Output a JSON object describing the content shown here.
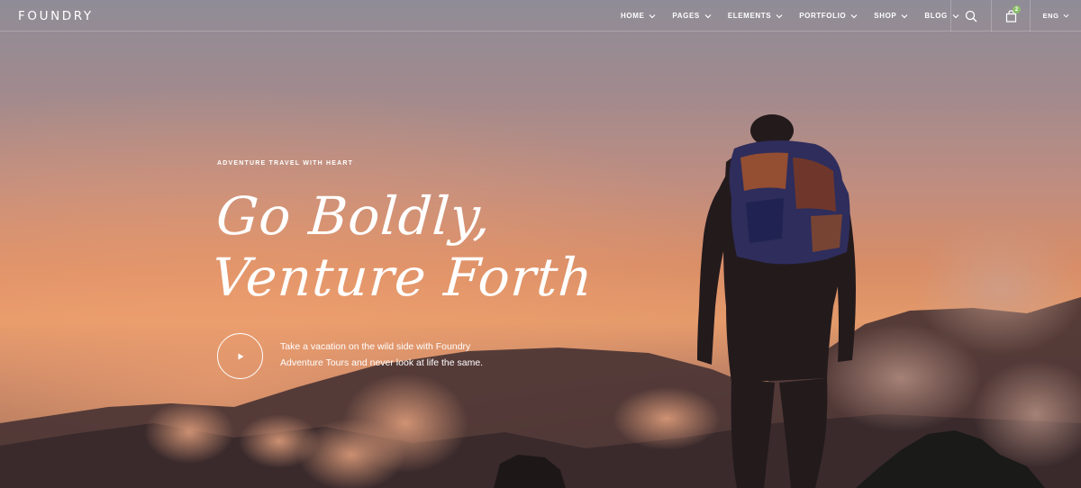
{
  "brand": {
    "logo_text": "FOUNDRY"
  },
  "nav": {
    "items": [
      {
        "label": "HOME"
      },
      {
        "label": "PAGES"
      },
      {
        "label": "ELEMENTS"
      },
      {
        "label": "PORTFOLIO"
      },
      {
        "label": "SHOP"
      },
      {
        "label": "BLOG"
      }
    ],
    "search_icon": "search-icon",
    "cart_icon": "shopping-bag-icon",
    "cart_count": "2",
    "language": "ENG"
  },
  "hero": {
    "eyebrow": "ADVENTURE TRAVEL WITH HEART",
    "headline_line1": "Go Boldly,",
    "headline_line2": "Venture Forth",
    "play_icon": "play-icon",
    "tagline_line1": "Take a vacation on the wild side with Foundry",
    "tagline_line2": "Adventure Tours and never look at life the same."
  },
  "colors": {
    "cart_badge": "#8bbf6a",
    "text": "#ffffff",
    "sky_top": "#8f8c97",
    "sky_glow": "#e49a6a"
  }
}
